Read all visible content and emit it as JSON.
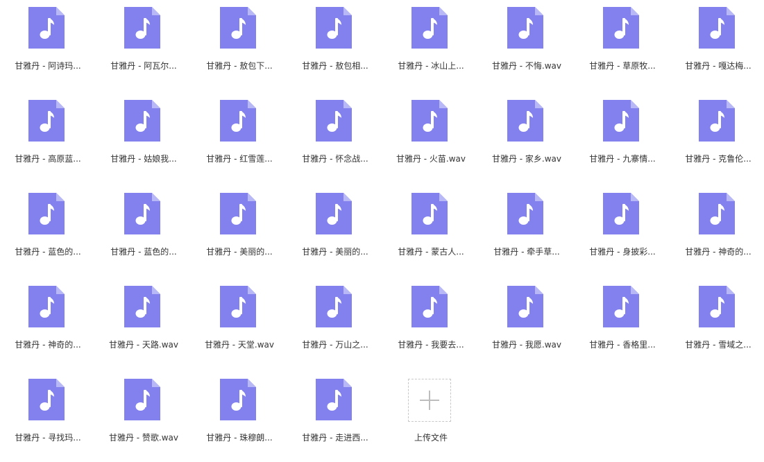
{
  "colors": {
    "file_icon_body": "#8281EE",
    "file_icon_fold": "#B9B8F7",
    "file_icon_glyph": "#FFFFFF",
    "text": "#333333",
    "upload_border": "#C7C7C7",
    "upload_plus": "#BDBDBD"
  },
  "file_icon": "music-file-icon",
  "files": [
    {
      "name": "甘雅丹 - 阿诗玛..."
    },
    {
      "name": "甘雅丹 - 阿瓦尔..."
    },
    {
      "name": "甘雅丹 - 敖包下..."
    },
    {
      "name": "甘雅丹 - 敖包相..."
    },
    {
      "name": "甘雅丹 - 冰山上..."
    },
    {
      "name": "甘雅丹 - 不悔.wav"
    },
    {
      "name": "甘雅丹 - 草原牧..."
    },
    {
      "name": "甘雅丹 - 嘎达梅..."
    },
    {
      "name": "甘雅丹 - 高原蓝..."
    },
    {
      "name": "甘雅丹 - 姑娘我..."
    },
    {
      "name": "甘雅丹 - 红雪莲..."
    },
    {
      "name": "甘雅丹 - 怀念战..."
    },
    {
      "name": "甘雅丹 - 火苗.wav"
    },
    {
      "name": "甘雅丹 - 家乡.wav"
    },
    {
      "name": "甘雅丹 - 九寨情..."
    },
    {
      "name": "甘雅丹 - 克鲁伦..."
    },
    {
      "name": "甘雅丹 - 蓝色的..."
    },
    {
      "name": "甘雅丹 - 蓝色的..."
    },
    {
      "name": "甘雅丹 - 美丽的..."
    },
    {
      "name": "甘雅丹 - 美丽的..."
    },
    {
      "name": "甘雅丹 - 蒙古人..."
    },
    {
      "name": "甘雅丹 - 牵手草..."
    },
    {
      "name": "甘雅丹 - 身披彩..."
    },
    {
      "name": "甘雅丹 - 神奇的..."
    },
    {
      "name": "甘雅丹 - 神奇的..."
    },
    {
      "name": "甘雅丹 - 天路.wav"
    },
    {
      "name": "甘雅丹 - 天堂.wav"
    },
    {
      "name": "甘雅丹 - 万山之..."
    },
    {
      "name": "甘雅丹 - 我要去..."
    },
    {
      "name": "甘雅丹 - 我愿.wav"
    },
    {
      "name": "甘雅丹 - 香格里..."
    },
    {
      "name": "甘雅丹 - 雪域之..."
    },
    {
      "name": "甘雅丹 - 寻找玛..."
    },
    {
      "name": "甘雅丹 - 赞歌.wav"
    },
    {
      "name": "甘雅丹 - 珠穆朗..."
    },
    {
      "name": "甘雅丹 - 走进西..."
    }
  ],
  "upload": {
    "label": "上传文件",
    "icon": "plus-icon"
  }
}
